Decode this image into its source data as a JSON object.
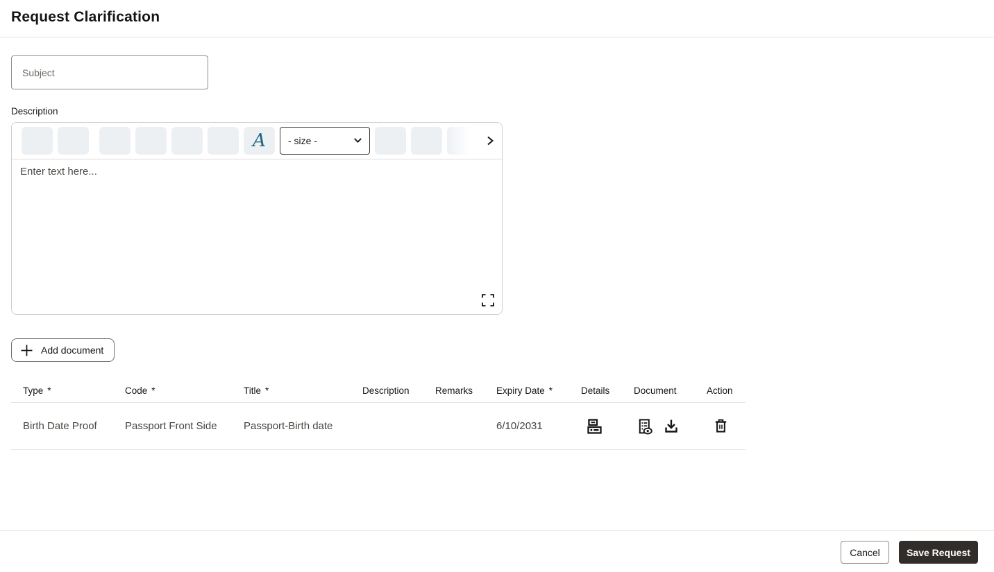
{
  "page": {
    "title": "Request Clarification"
  },
  "form": {
    "subject_placeholder": "Subject",
    "description_label": "Description",
    "editor": {
      "placeholder": "Enter text here...",
      "font_button_label": "A",
      "size_select_value": "- size -"
    }
  },
  "documents": {
    "add_button_label": "Add document",
    "table": {
      "columns": [
        {
          "label": "Type",
          "required": "*"
        },
        {
          "label": "Code",
          "required": "*"
        },
        {
          "label": "Title",
          "required": "*"
        },
        {
          "label": "Description",
          "required": ""
        },
        {
          "label": "Remarks",
          "required": ""
        },
        {
          "label": "Expiry Date",
          "required": "*"
        },
        {
          "label": "Details",
          "required": ""
        },
        {
          "label": "Document",
          "required": ""
        },
        {
          "label": "Action",
          "required": ""
        }
      ],
      "rows": [
        {
          "type": "Birth Date Proof",
          "code": "Passport Front Side",
          "title": "Passport-Birth date",
          "description": "",
          "remarks": "",
          "expiry_date": "6/10/2031"
        }
      ]
    }
  },
  "footer": {
    "cancel_label": "Cancel",
    "save_label": "Save Request"
  },
  "colors": {
    "accent_teal": "#19647e",
    "primary_button_bg": "#312d2a",
    "toolbar_button_bg": "#edf0f3",
    "text_primary": "#161513",
    "text_row": "#47433f"
  }
}
